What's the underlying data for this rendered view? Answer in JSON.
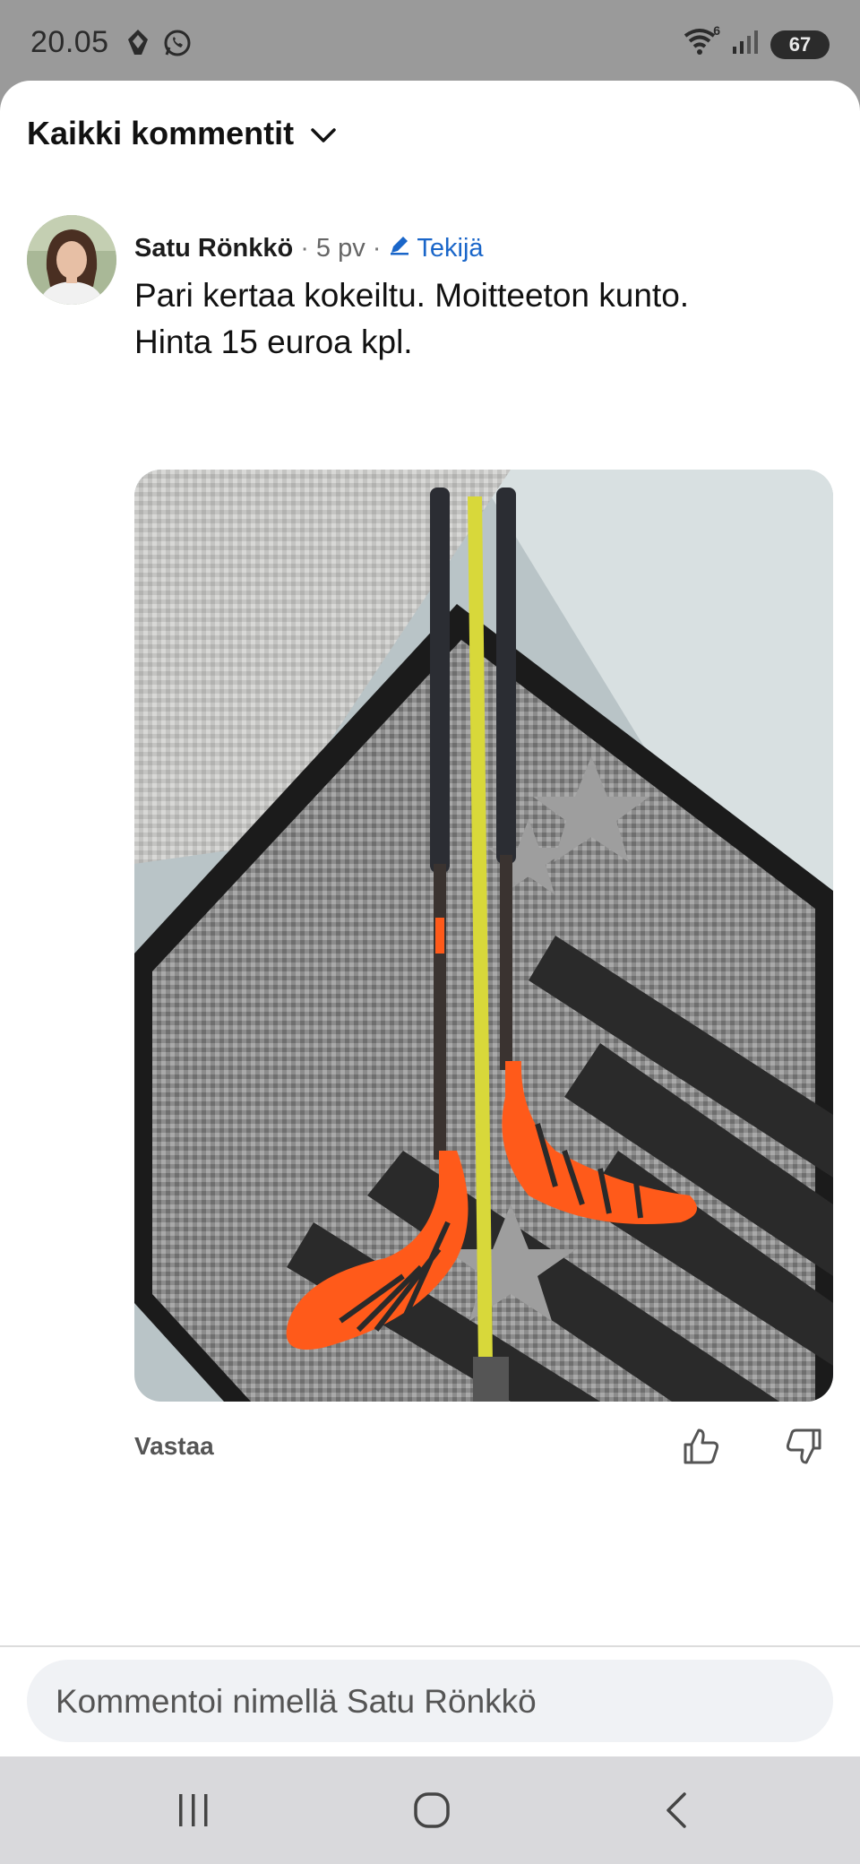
{
  "status_bar": {
    "time": "20.05",
    "battery": "67",
    "network": "6"
  },
  "sheet": {
    "title": "Kaikki kommentit"
  },
  "comment": {
    "author": "Satu Rönkkö",
    "time_ago": "5 pv",
    "author_badge": "Tekijä",
    "text_line1": "Pari kertaa kokeiltu. Moitteeton kunto.",
    "text_line2": "Hinta 15 euroa kpl.",
    "reply_label": "Vastaa"
  },
  "composer": {
    "placeholder": "Kommentoi nimellä Satu Rönkkö"
  },
  "icons": {
    "dropdown": "chevron-down-icon",
    "badge": "pencil-icon",
    "like": "thumbs-up-icon",
    "dislike": "thumbs-down-icon"
  },
  "colors": {
    "badge": "#1a66c9",
    "stick_blade": "#ff5a1a"
  }
}
